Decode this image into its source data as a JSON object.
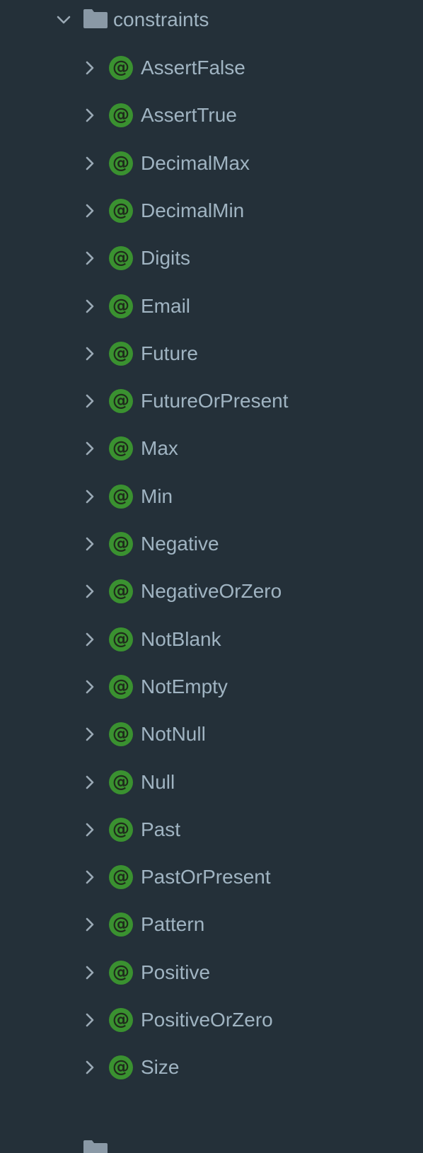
{
  "tree": {
    "folder": {
      "name": "constraints",
      "icon": "folder-icon",
      "expanded": true
    },
    "annotation_icon_glyph": "@",
    "items": [
      {
        "label": "AssertFalse"
      },
      {
        "label": "AssertTrue"
      },
      {
        "label": "DecimalMax"
      },
      {
        "label": "DecimalMin"
      },
      {
        "label": "Digits"
      },
      {
        "label": "Email"
      },
      {
        "label": "Future"
      },
      {
        "label": "FutureOrPresent"
      },
      {
        "label": "Max"
      },
      {
        "label": "Min"
      },
      {
        "label": "Negative"
      },
      {
        "label": "NegativeOrZero"
      },
      {
        "label": "NotBlank"
      },
      {
        "label": "NotEmpty"
      },
      {
        "label": "NotNull"
      },
      {
        "label": "Null"
      },
      {
        "label": "Past"
      },
      {
        "label": "PastOrPresent"
      },
      {
        "label": "Pattern"
      },
      {
        "label": "Positive"
      },
      {
        "label": "PositiveOrZero"
      },
      {
        "label": "Size"
      }
    ],
    "colors": {
      "background": "#243039",
      "text": "#a0b4c2",
      "annotation_badge": "#3a9130",
      "folder": "#8a99a6",
      "chevron": "#9aa9b5"
    }
  }
}
